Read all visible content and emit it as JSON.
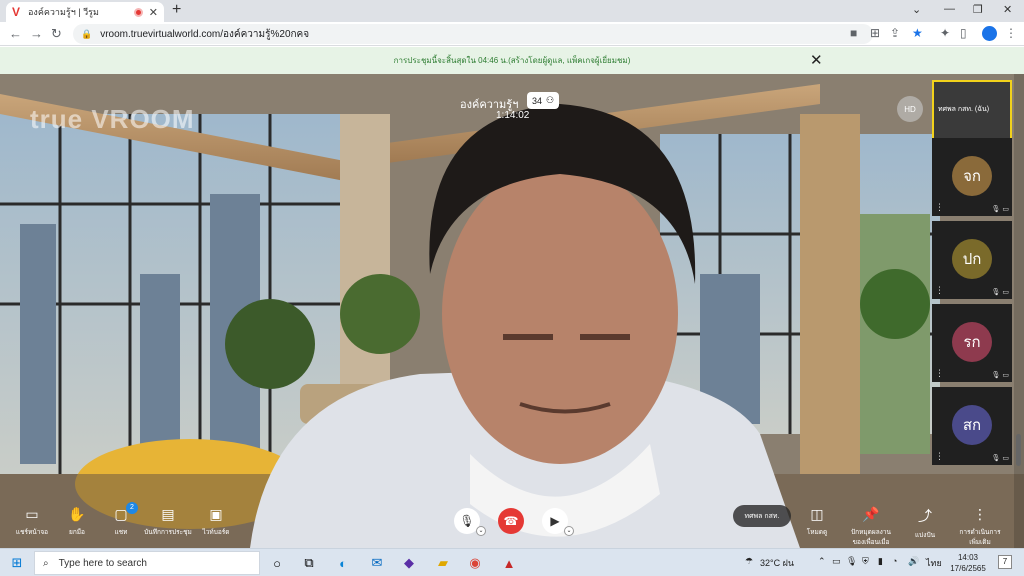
{
  "browser": {
    "tab_title": "องค์ความรู้ฯ | วีรูม",
    "url": "vroom.truevirtualworld.com/องค์ความรู้%20กคจ"
  },
  "notice": {
    "text": "การประชุมนี้จะสิ้นสุดใน 04:46 น.(สร้างโดยผู้ดูแล, แพ็คเกจผู้เยี่ยมชม)"
  },
  "meeting": {
    "brand": "true VROOM",
    "title": "องค์ความรู้ฯ",
    "participant_count": "34",
    "elapsed": "1:14:02",
    "hd_label": "HD",
    "active_speaker": "ทศพล กสท."
  },
  "participants": [
    {
      "name": "ทศพล กสท. (ฉัน)",
      "initials": "",
      "color": "#3a3a3a"
    },
    {
      "name": "",
      "initials": "จก",
      "color": "#8a6a3a"
    },
    {
      "name": "",
      "initials": "ปก",
      "color": "#7a6a2a"
    },
    {
      "name": "",
      "initials": "รก",
      "color": "#8e3a4e"
    },
    {
      "name": "",
      "initials": "สก",
      "color": "#4a4a8a"
    }
  ],
  "controls_left": [
    {
      "label": "แชร์หน้าจอ",
      "icon": "screen-share-icon"
    },
    {
      "label": "ยกมือ",
      "icon": "hand-icon"
    },
    {
      "label": "แชท",
      "icon": "chat-icon",
      "badge": "2"
    },
    {
      "label": "บันทึกการประชุม",
      "icon": "notes-icon"
    },
    {
      "label": "ไวท์บอร์ด",
      "icon": "whiteboard-icon"
    }
  ],
  "controls_right": [
    {
      "label": "โหมดดู",
      "icon": "layout-icon"
    },
    {
      "label": "ปักหมุดผลงานของเพื่อนเมื่อ",
      "icon": "pin-icon"
    },
    {
      "label": "แบ่งปัน",
      "icon": "share-icon"
    },
    {
      "label": "การดำเนินการเพิ่มเติม",
      "icon": "more-icon"
    }
  ],
  "taskbar": {
    "search_placeholder": "Type here to search",
    "weather": "32°C ฝน",
    "lang": "ไทย",
    "time": "14:03",
    "date": "17/6/2565",
    "notif_count": "7"
  },
  "colors": {
    "end_call": "#e53935",
    "notice_bg": "#e7f3e6",
    "self_border": "#f2d21b"
  }
}
